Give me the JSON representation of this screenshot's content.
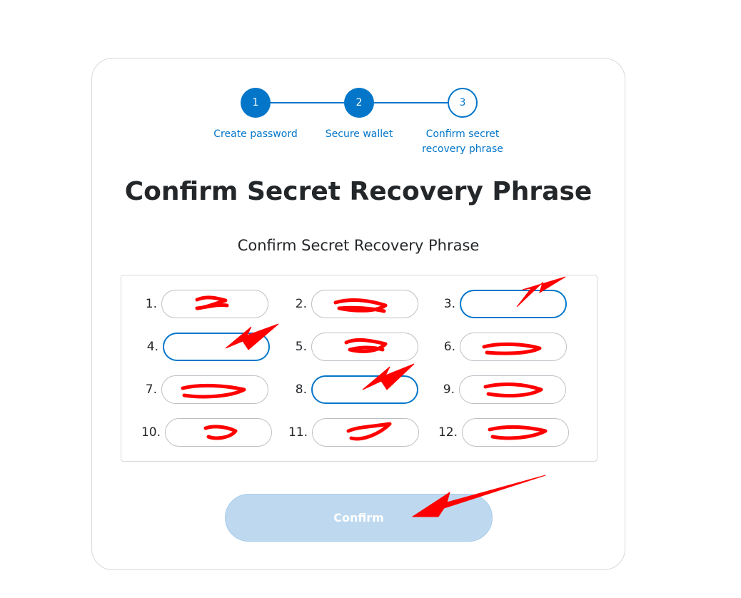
{
  "stepper": {
    "steps": [
      {
        "number": "1",
        "label_line1": "Create password",
        "label_line2": "",
        "state": "done"
      },
      {
        "number": "2",
        "label_line1": "Secure wallet",
        "label_line2": "",
        "state": "done"
      },
      {
        "number": "3",
        "label_line1": "Confirm secret",
        "label_line2": "recovery phrase",
        "state": "pending"
      }
    ]
  },
  "page": {
    "title": "Confirm Secret Recovery Phrase",
    "subtitle": "Confirm Secret Recovery Phrase"
  },
  "words": [
    {
      "number": "1.",
      "value": "",
      "empty": false
    },
    {
      "number": "2.",
      "value": "",
      "empty": false
    },
    {
      "number": "3.",
      "value": "",
      "empty": true
    },
    {
      "number": "4.",
      "value": "",
      "empty": true
    },
    {
      "number": "5.",
      "value": "",
      "empty": false
    },
    {
      "number": "6.",
      "value": "",
      "empty": false
    },
    {
      "number": "7.",
      "value": "",
      "empty": false
    },
    {
      "number": "8.",
      "value": "",
      "empty": true
    },
    {
      "number": "9.",
      "value": "",
      "empty": false
    },
    {
      "number": "10.",
      "value": "",
      "empty": false
    },
    {
      "number": "11.",
      "value": "",
      "empty": false
    },
    {
      "number": "12.",
      "value": "",
      "empty": false
    }
  ],
  "confirm_button": {
    "label": "Confirm",
    "enabled": false
  },
  "colors": {
    "accent": "#0376c9",
    "button_disabled": "#bed9ef",
    "annotation_red": "#ff0000",
    "text": "#24272a"
  }
}
